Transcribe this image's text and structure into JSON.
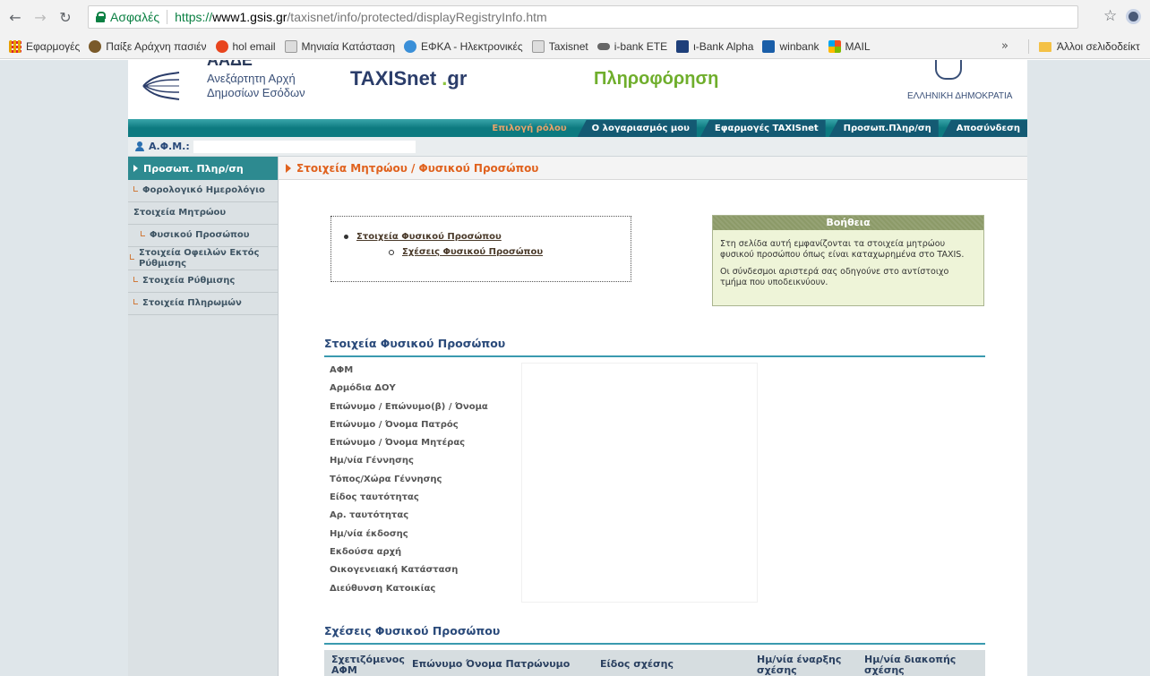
{
  "browser": {
    "secure_label": "Ασφαλές",
    "url_scheme": "https://",
    "url_host": "www1.gsis.gr",
    "url_path": "/taxisnet/info/protected/displayRegistryInfo.htm",
    "overflow_chevron": "»",
    "bookmarks": [
      {
        "label": "Εφαρμογές",
        "icon": "apps-grid-icon"
      },
      {
        "label": "Παίξε Αράχνη πασιέν",
        "icon": "spider-icon"
      },
      {
        "label": "hol email",
        "icon": "hol-icon"
      },
      {
        "label": "Μηνιαία Κατάσταση",
        "icon": "gsis-icon"
      },
      {
        "label": "ΕΦΚΑ - Ηλεκτρονικές",
        "icon": "efka-icon"
      },
      {
        "label": "Taxisnet",
        "icon": "gsis-icon"
      },
      {
        "label": "i-bank ETE",
        "icon": "ibank-icon"
      },
      {
        "label": "ι-Bank Alpha",
        "icon": "alpha-bank-icon"
      },
      {
        "label": "winbank",
        "icon": "winbank-icon"
      },
      {
        "label": "MAIL",
        "icon": "mail-icon"
      }
    ],
    "other_bookmarks": "Άλλοι σελιδοδείκτ"
  },
  "header": {
    "org_abbr": "ΑΑΔΕ",
    "org_line1": "Ανεξάρτητη Αρχή",
    "org_line2": "Δημοσίων Εσόδων",
    "brand_main": "TAXISnet",
    "brand_dot": ".",
    "brand_tld": "gr",
    "tagline": "Πληροφόρηση",
    "country": "ΕΛΛΗΝΙΚΗ ΔΗΜΟΚΡΑΤΙΑ"
  },
  "nav": {
    "tabs": [
      "Επιλογή ρόλου",
      "Ο λογαριασμός μου",
      "Εφαρμογές TAXISnet",
      "Προσωπ.Πληρ/ση",
      "Αποσύνδεση"
    ]
  },
  "user": {
    "afm_label": "Α.Φ.Μ.:"
  },
  "sidebar": {
    "active": "Προσωπ. Πληρ/ση",
    "items": [
      {
        "label": "Φορολογικό Ημερολόγιο",
        "corner": true
      },
      {
        "label": "Στοιχεία Μητρώου",
        "corner": false
      },
      {
        "label": "Φυσικού Προσώπου",
        "corner": true
      },
      {
        "label": "Στοιχεία Οφειλών Εκτός Ρύθμισης",
        "corner": true
      },
      {
        "label": "Στοιχεία Ρύθμισης",
        "corner": true
      },
      {
        "label": "Στοιχεία Πληρωμών",
        "corner": true
      }
    ]
  },
  "main": {
    "title": "Στοιχεία Μητρώου / Φυσικού Προσώπου",
    "toc": {
      "level1": "Στοιχεία Φυσικού Προσώπου",
      "level2": "Σχέσεις Φυσικού Προσώπου"
    },
    "help": {
      "title": "Βοήθεια",
      "paragraph1": "Στη σελίδα αυτή εμφανίζονται τα στοιχεία μητρώου φυσικού προσώπου όπως είναι καταχωρημένα στο TAXIS.",
      "paragraph2": "Οι σύνδεσμοι αριστερά σας οδηγούνε στο αντίστοιχο τμήμα που υποδεικνύουν."
    },
    "person_section": {
      "title": "Στοιχεία Φυσικού Προσώπου",
      "fields": [
        "ΑΦΜ",
        "Αρμόδια ΔΟΥ",
        "Επώνυμο / Επώνυμο(β) / Όνομα",
        "Επώνυμο / Όνομα Πατρός",
        "Επώνυμο / Όνομα Μητέρας",
        "Ημ/νία Γέννησης",
        "Τόπος/Χώρα Γέννησης",
        "Είδος ταυτότητας",
        "Αρ. ταυτότητας",
        "Ημ/νία έκδοσης",
        "Εκδούσα αρχή",
        "Οικογενειακή Κατάσταση",
        "Διεύθυνση Κατοικίας"
      ]
    },
    "relations_section": {
      "title": "Σχέσεις Φυσικού Προσώπου",
      "columns": [
        "Σχετιζόμενος ΑΦΜ",
        "Επώνυμο Όνομα Πατρώνυμο",
        "Είδος σχέσης",
        "Ημ/νία έναρξης σχέσης",
        "Ημ/νία διακοπής σχέσης"
      ]
    }
  },
  "colors": {
    "nav_teal": "#0d7a80",
    "sidebar_active": "#2d8a90",
    "title_orange": "#e0621e",
    "section_blue": "#2a4a7a",
    "help_header": "#8c9a68",
    "help_bg": "#eef4d8"
  }
}
